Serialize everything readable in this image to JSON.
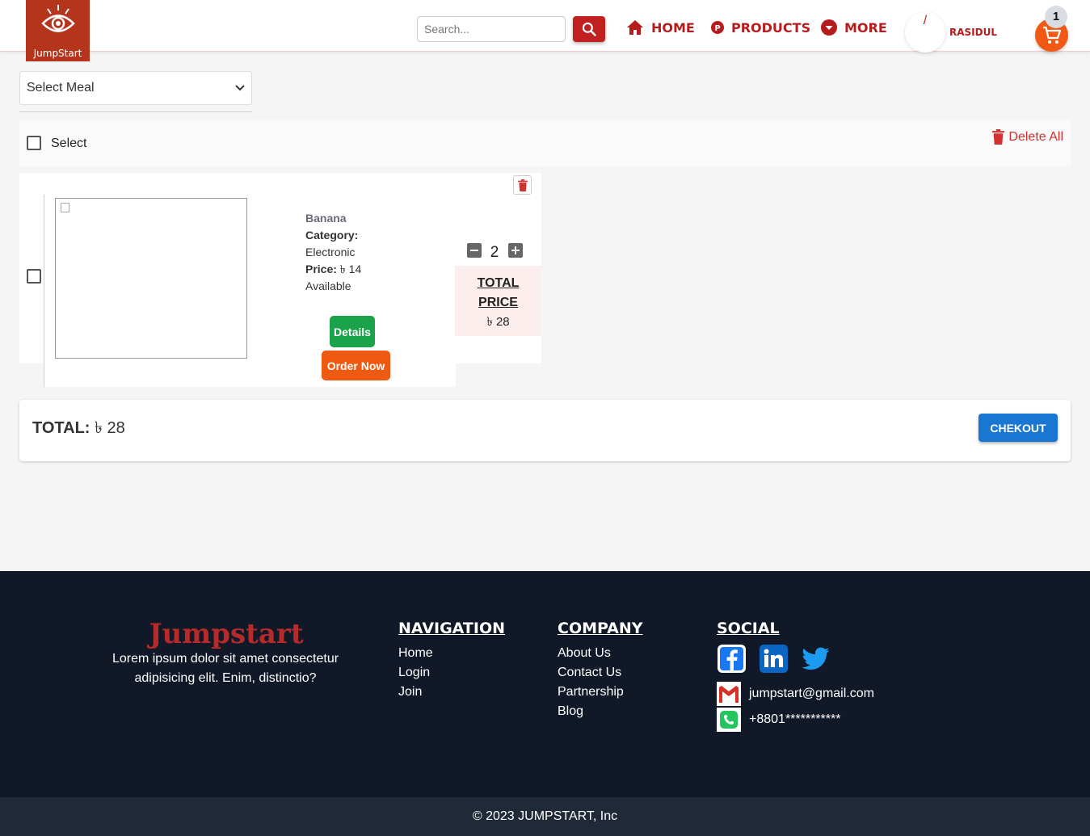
{
  "header": {
    "logo_text": "JumpStart",
    "search": {
      "placeholder": "Search..."
    },
    "nav": {
      "home": "HOME",
      "products": "PRODUCTS",
      "more": "MORE"
    },
    "user": {
      "name": "RASIDUL"
    },
    "cart": {
      "count": "1"
    }
  },
  "meal_select": {
    "selected": "Select Meal"
  },
  "select_bar": {
    "select_label": "Select",
    "delete_all": "Delete All"
  },
  "cart_item": {
    "name": "Banana",
    "category_label": "Category:",
    "category": "Electronic",
    "price_label": "Price:",
    "price": " ৳ 14",
    "availability": "Available",
    "details_label": "Details",
    "order_label": "Order Now",
    "quantity": "2",
    "total_label": "TOTAL PRICE",
    "total_price": "৳ 28"
  },
  "summary": {
    "total_label": "TOTAL:",
    "total_value": " ৳ 28",
    "checkout_label": "CHEKOUT"
  },
  "footer": {
    "brand": "Jumpstart",
    "description": "Lorem ipsum dolor sit amet consectetur adipisicing elit. Enim, distinctio?",
    "navigation": {
      "title": "NAVIGATION",
      "links": [
        "Home",
        "Login",
        "Join"
      ]
    },
    "company": {
      "title": "COMPANY",
      "links": [
        "About Us",
        "Contact Us",
        "Partnership",
        "Blog"
      ]
    },
    "social": {
      "title": "SOCIAL",
      "email": "jumpstart@gmail.com",
      "phone": "+8801***********"
    },
    "copyright": "© 2023 JUMPSTART, Inc"
  },
  "icons": {
    "logo": "eye-icon",
    "search": "search-icon",
    "home": "home-icon",
    "products": "products-icon",
    "more": "arrow-down-circle-icon",
    "cart": "cart-icon",
    "dropdown": "chevron-down-icon",
    "delete": "trash-icon",
    "facebook": "facebook-icon",
    "linkedin": "linkedin-icon",
    "twitter": "twitter-icon",
    "gmail": "gmail-icon",
    "phone": "phone-icon"
  },
  "colors": {
    "brand_red": "#b71c1c",
    "logo_bg": "#b5341c",
    "cart_orange": "#f05a14",
    "details_green": "#1aa34a",
    "order_orange": "#ef5a12",
    "checkout_blue": "#1976d2",
    "footer_bg": "#111827"
  }
}
